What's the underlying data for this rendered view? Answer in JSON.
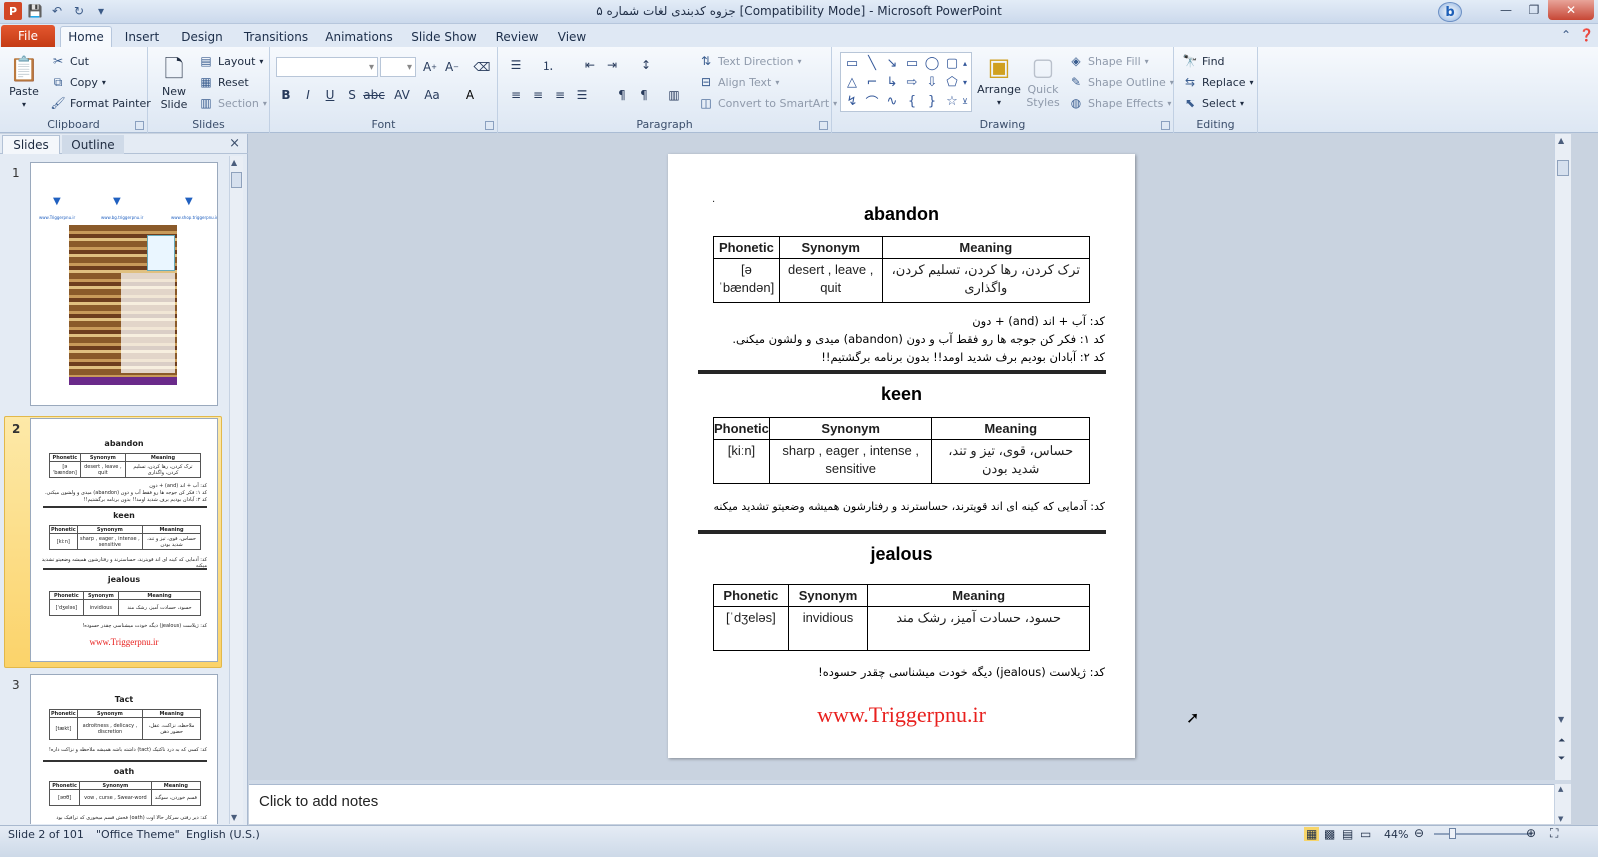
{
  "window": {
    "title": "جزوه کدبندی لغات شماره ۵ [Compatibility Mode]  -  Microsoft PowerPoint",
    "app_icon": "P",
    "bing": "b"
  },
  "ribbon_tabs": {
    "file": "File",
    "tabs": [
      "Home",
      "Insert",
      "Design",
      "Transitions",
      "Animations",
      "Slide Show",
      "Review",
      "View"
    ]
  },
  "clipboard": {
    "paste": "Paste",
    "cut": "Cut",
    "copy": "Copy",
    "format_painter": "Format Painter",
    "label": "Clipboard"
  },
  "slides_group": {
    "new_slide": "New\nSlide",
    "layout": "Layout",
    "reset": "Reset",
    "section": "Section",
    "label": "Slides"
  },
  "font_group": {
    "label": "Font"
  },
  "paragraph_group": {
    "text_direction": "Text Direction",
    "align_text": "Align Text",
    "convert_smartart": "Convert to SmartArt",
    "label": "Paragraph"
  },
  "drawing_group": {
    "arrange": "Arrange",
    "quick_styles": "Quick\nStyles",
    "shape_fill": "Shape Fill",
    "shape_outline": "Shape Outline",
    "shape_effects": "Shape Effects",
    "label": "Drawing"
  },
  "editing_group": {
    "find": "Find",
    "replace": "Replace",
    "select": "Select",
    "label": "Editing"
  },
  "left_pane": {
    "tab_slides": "Slides",
    "tab_outline": "Outline",
    "close": "×",
    "slide_numbers": [
      "1",
      "2",
      "3"
    ]
  },
  "thumb1": {
    "site_a": "www.Triggerpnu.ir",
    "site_b": "www.bg.triggerpnu.ir",
    "site_c": "www.shop.triggerpnu.ir"
  },
  "thumb_site": "www.Triggerpnu.ir",
  "thumb3": {
    "word1": "Tact",
    "w1_phonetic": "[tækt]",
    "w1_synonym": "adroitness , delicacy , discretion",
    "w1_meaning": "ملاحظه، نزاکت، عقل، حضور ذهن",
    "w1_code": "کد: کسی که به درد ناکتیک (tact) داشته باشه همیشه ملاحظه و نزاکت داره!",
    "word2": "oath",
    "w2_phonetic": "[əʊθ]",
    "w2_synonym": "vow , curse , Swear-word",
    "w2_meaning": "قسم خوردن، سوگند",
    "w2_code": "کد: دیر رفتی سرکار حالا اوت (oath) فحش قسم میخوری که ترافیک بود"
  },
  "table_headers": {
    "phonetic": "Phonetic",
    "synonym": "Synonym",
    "meaning": "Meaning"
  },
  "slide": {
    "dot": ".",
    "words": [
      {
        "title": "abandon",
        "phonetic": "[əˈbændən]",
        "synonym": "desert , leave , quit",
        "meaning": "ترک کردن، رها کردن، تسلیم کردن، واگذاری",
        "codes": [
          "کد: آب + اند (and) + دون",
          "کد ۱: فکر کن جوجه ها رو فقط آب و دون (abandon) میدی و ولشون میکنی.",
          "کد ۲: آبادان بودیم برف شدید اومد!! بدون برنامه برگشتیم!!"
        ]
      },
      {
        "title": "keen",
        "phonetic": "[kiːn]",
        "synonym": "sharp , eager , intense , sensitive",
        "meaning": "حساس، قوی، تیز و تند، شدید بودن",
        "codes": [
          "کد: آدمایی که کینه ای اند قویترند، حساسترند و رفتارشون همیشه وضعیتو تشدید میکنه"
        ]
      },
      {
        "title": "jealous",
        "phonetic": "[ˈdʒeləs]",
        "synonym": "invidious",
        "meaning": "حسود، حسادت آمیز، رشک مند",
        "codes": [
          "کد: ژیلاست (jealous) دیگه خودت میشناسی چقدر حسوده!"
        ]
      }
    ],
    "site": "www.Triggerpnu.ir"
  },
  "notes": {
    "placeholder": "Click to add notes"
  },
  "status": {
    "slide_of": "Slide 2 of 101",
    "theme": "\"Office Theme\"",
    "language": "English (U.S.)",
    "zoom": "44%",
    "zoom_level_percent": 44
  },
  "colors": {
    "file_tab": "#d24726",
    "selected_thumb": "#fbd36a",
    "site_red": "#e8201e"
  }
}
